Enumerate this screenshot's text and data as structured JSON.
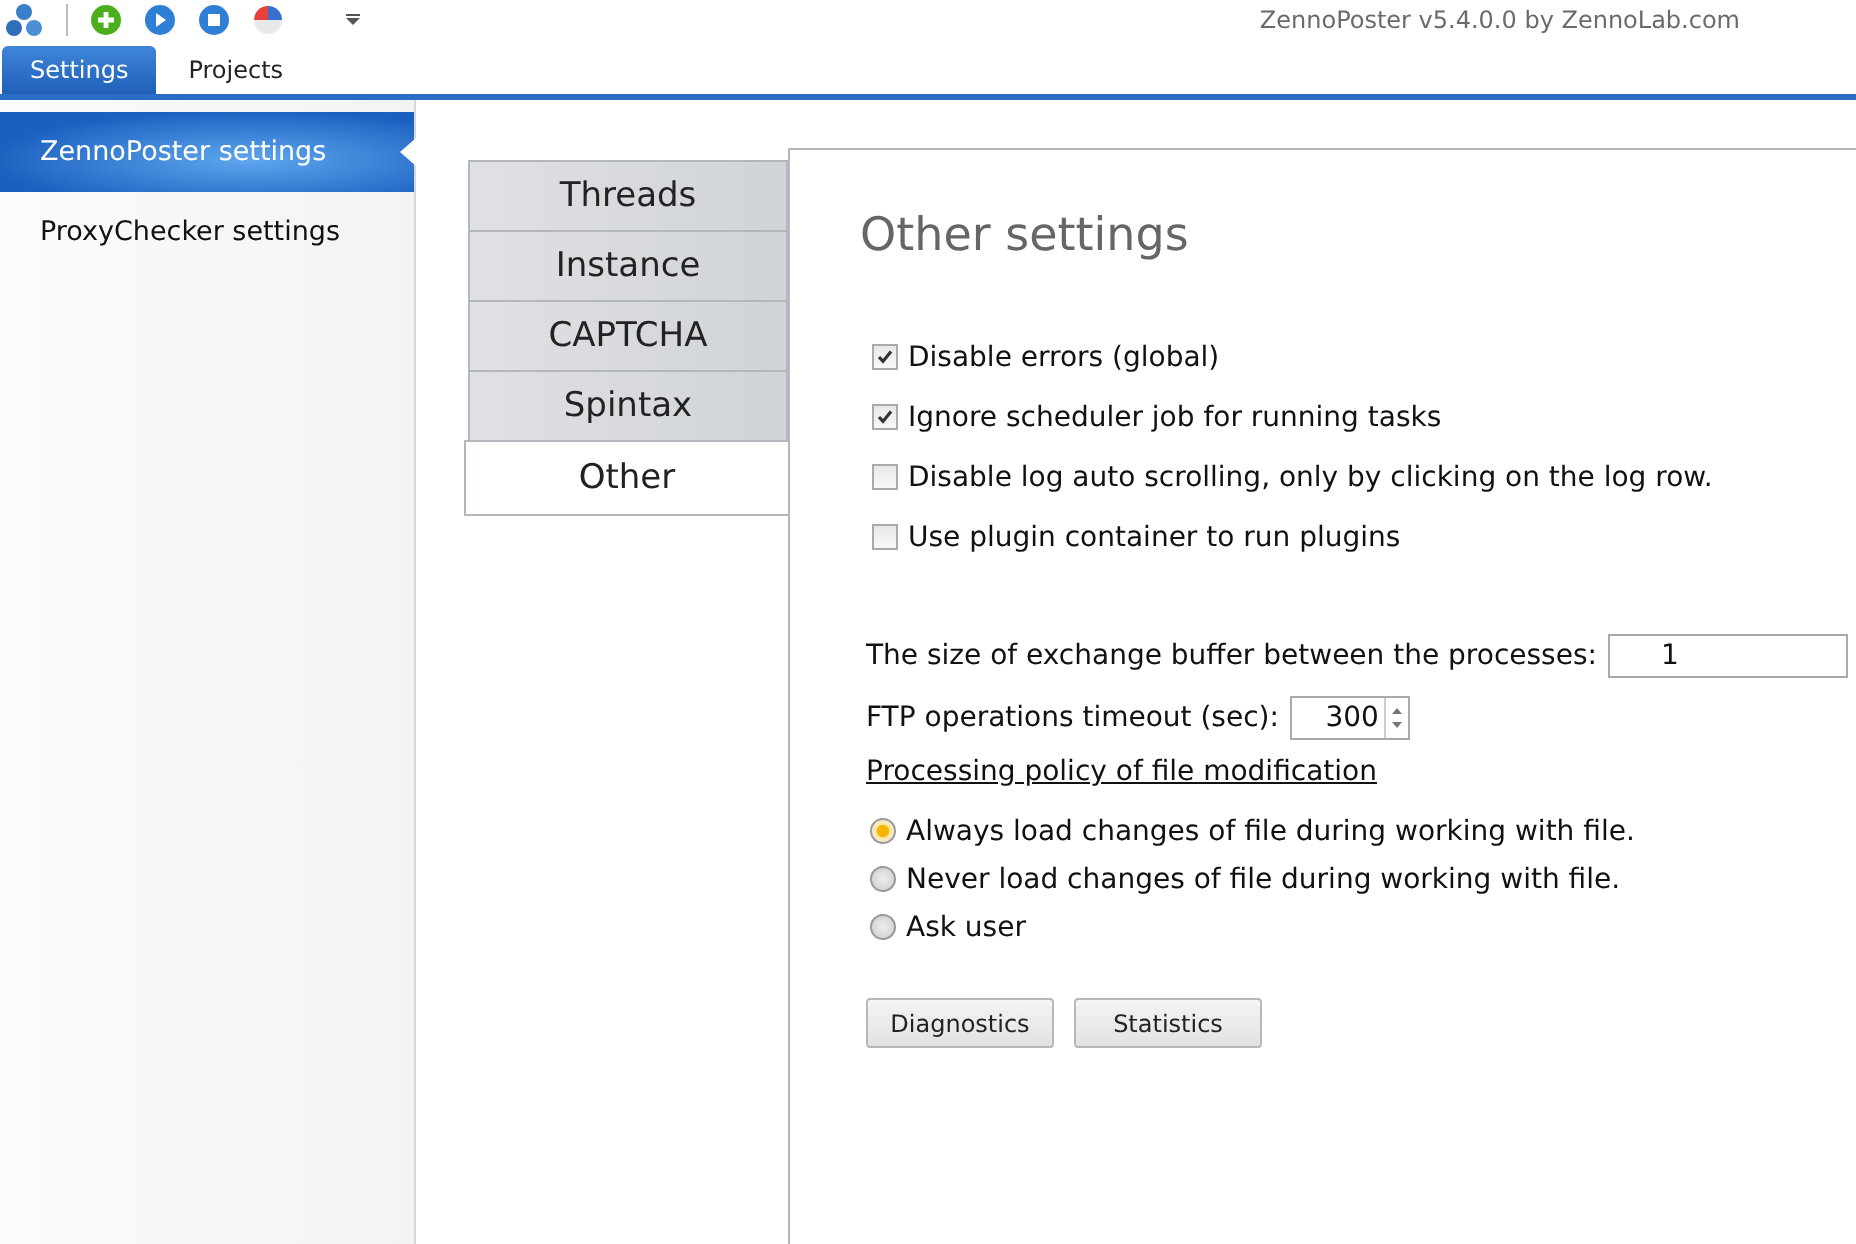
{
  "window": {
    "title": "ZennoPoster v5.4.0.0 by ZennoLab.com"
  },
  "ribbon_tabs": [
    {
      "label": "Settings",
      "selected": true
    },
    {
      "label": "Projects",
      "selected": false
    }
  ],
  "sidebar": {
    "items": [
      {
        "label": "ZennoPoster settings",
        "selected": true
      },
      {
        "label": "ProxyChecker settings",
        "selected": false
      }
    ]
  },
  "settings_tabs": [
    {
      "label": "Threads",
      "selected": false
    },
    {
      "label": "Instance",
      "selected": false
    },
    {
      "label": "CAPTCHA",
      "selected": false
    },
    {
      "label": "Spintax",
      "selected": false
    },
    {
      "label": "Other",
      "selected": true
    }
  ],
  "panel": {
    "heading": "Other settings",
    "checkboxes": [
      {
        "label": "Disable errors (global)",
        "checked": true
      },
      {
        "label": "Ignore scheduler job for running tasks",
        "checked": true
      },
      {
        "label": "Disable log auto scrolling, only by clicking on the log row.",
        "checked": false
      },
      {
        "label": "Use plugin container to run plugins",
        "checked": false
      }
    ],
    "buffer": {
      "label": "The size of exchange buffer between the processes:",
      "value": "1"
    },
    "ftp_timeout": {
      "label": "FTP operations timeout (sec):",
      "value": "300"
    },
    "policy_link": "Processing policy of file modification",
    "radios": [
      {
        "label": "Always load changes of file during working with file.",
        "selected": true
      },
      {
        "label": "Never load changes of file during working with file.",
        "selected": false
      },
      {
        "label": "Ask user",
        "selected": false
      }
    ],
    "buttons": [
      "Diagnostics",
      "Statistics"
    ]
  }
}
